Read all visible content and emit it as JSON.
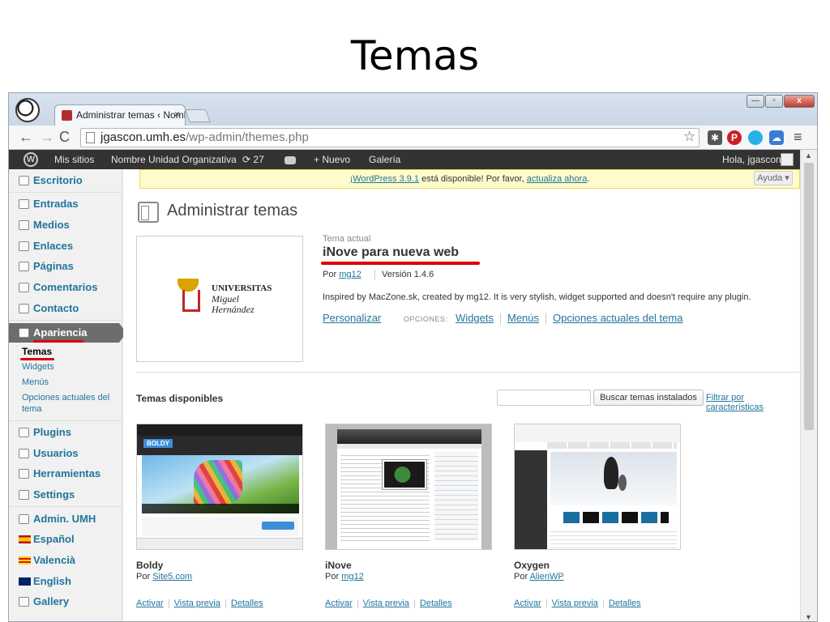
{
  "slide": {
    "title": "Temas"
  },
  "browser": {
    "tab_title": "Administrar temas ‹ Noml",
    "tab_close": "×",
    "url_host": "jgascon.umh.es",
    "url_path": "/wp-admin/themes.php",
    "icons": [
      "back-arrow",
      "forward-arrow",
      "reload",
      "star",
      "pinterest",
      "menu"
    ]
  },
  "adminbar": {
    "logo": "W",
    "sites": "Mis sitios",
    "unit": "Nombre Unidad Organizativa",
    "updates": "⟳ 27",
    "new": "+ Nuevo",
    "gallery": "Galería",
    "howdy": "Hola, jgascon"
  },
  "sidebar": {
    "escritorio": "Escritorio",
    "entradas": "Entradas",
    "medios": "Medios",
    "enlaces": "Enlaces",
    "paginas": "Páginas",
    "comentarios": "Comentarios",
    "contacto": "Contacto",
    "apariencia": "Apariencia",
    "submenu": [
      "Temas",
      "Widgets",
      "Menús",
      "Opciones actuales del tema"
    ],
    "plugins": "Plugins",
    "usuarios": "Usuarios",
    "herramientas": "Herramientas",
    "settings": "Settings",
    "admin_umh": "Admin. UMH",
    "espanol": "Español",
    "valencia": "Valencià",
    "english": "English",
    "gallery": "Gallery"
  },
  "notice": {
    "link1": "¡WordPress 3.9.1",
    "middle": " está disponible! Por favor, ",
    "link2": "actualiza ahora",
    "end": "."
  },
  "help_tab": "Ayuda ▾",
  "page_title": "Administrar temas",
  "current_theme": {
    "label": "Tema actual",
    "name": "iNove para nueva web",
    "by": "Por ",
    "author": "mg12",
    "version": "Versión 1.4.6",
    "description": "Inspired by MacZone.sk, created by mg12. It is very stylish, widget supported and doesn't require any plugin.",
    "customize": "Personalizar",
    "options_label": "OPCIONES:",
    "options": [
      "Widgets",
      "Menús",
      "Opciones actuales del tema"
    ],
    "logo_text_1": "UNIVERSITAS",
    "logo_text_2": "Miguel",
    "logo_text_3": "Hernández"
  },
  "available": {
    "title": "Temas disponibles",
    "search_button": "Buscar temas instalados",
    "filter_link": "Filtrar por características",
    "actions": [
      "Activar",
      "Vista previa",
      "Detalles"
    ],
    "themes": [
      {
        "name": "Boldy",
        "by": "Por ",
        "author": "Site5.com",
        "thumb_logo": "BOLDY"
      },
      {
        "name": "iNove",
        "by": "Por ",
        "author": "mg12"
      },
      {
        "name": "Oxygen",
        "by": "Por ",
        "author": "AlienWP"
      }
    ]
  },
  "colors": {
    "link": "#21759b",
    "adminbar": "#333333",
    "active_menu": "#6d6d6d",
    "annotation": "#dd0000"
  }
}
